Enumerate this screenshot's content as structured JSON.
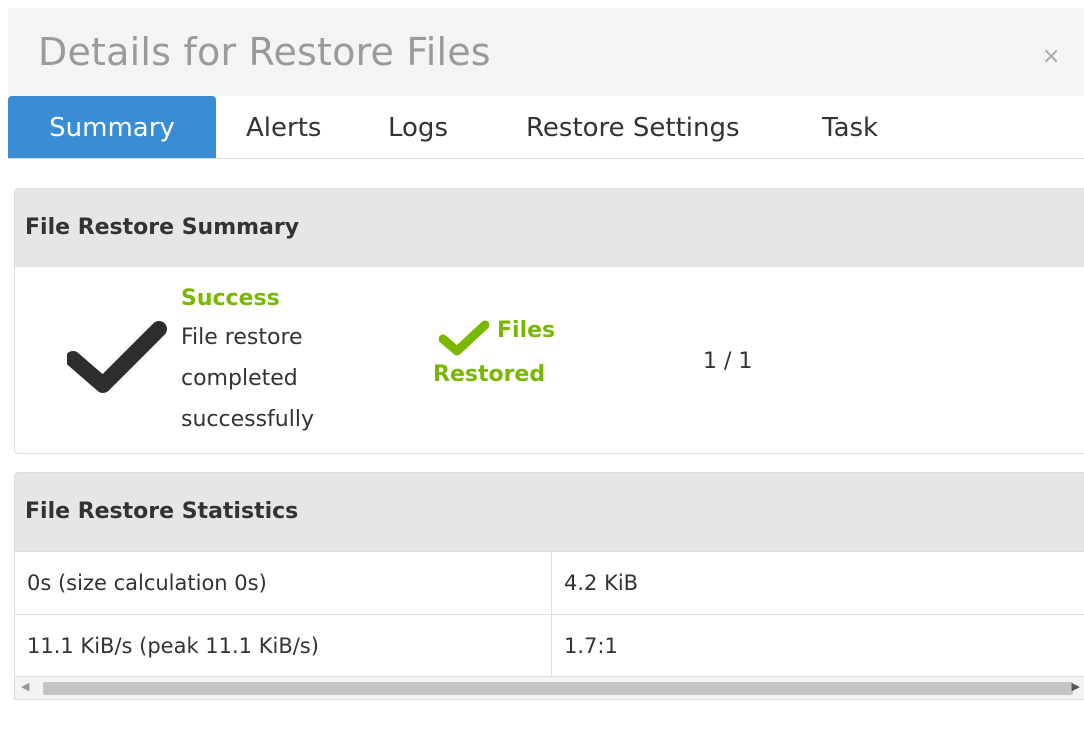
{
  "dialog": {
    "title": "Details for Restore Files",
    "close_symbol": "×"
  },
  "tabs": [
    {
      "label": "Summary",
      "active": true
    },
    {
      "label": "Alerts",
      "active": false
    },
    {
      "label": "Logs",
      "active": false
    },
    {
      "label": "Restore Settings",
      "active": false
    },
    {
      "label": "Task",
      "active": false
    }
  ],
  "summary": {
    "heading": "File Restore Summary",
    "status_title": "Success",
    "status_lines": [
      "File restore",
      "completed",
      "successfully"
    ],
    "files_lines": [
      "Files",
      "Restored"
    ],
    "files_count": "1 / 1",
    "status_icon": "checkmark-icon",
    "files_icon": "checkmark-icon",
    "status_color": "#7ab800"
  },
  "statistics": {
    "heading": "File Restore Statistics",
    "rows": [
      [
        "0s (size calculation 0s)",
        "4.2 KiB"
      ],
      [
        "11.1 KiB/s (peak 11.1 KiB/s)",
        "1.7:1"
      ]
    ]
  },
  "colors": {
    "tab_active": "#3a8dd4",
    "success": "#7ab800"
  }
}
